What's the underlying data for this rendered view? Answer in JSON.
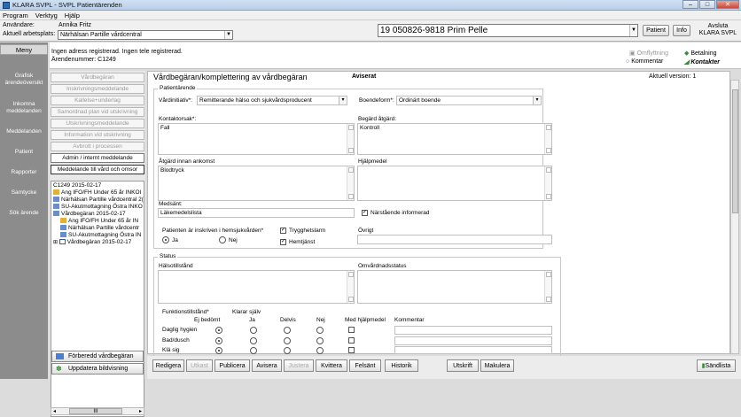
{
  "window": {
    "title": "KLARA SVPL - SVPL Patientärenden"
  },
  "menu": [
    "Program",
    "Verktyg",
    "Hjälp"
  ],
  "top": {
    "user_label": "Användare:",
    "user_value": "Annika Fritz",
    "workplace_label": "Aktuell arbetsplats:",
    "workplace_value": "Närhälsan Partille vårdcentral",
    "patient_value": "19 050826-9818 Prim Pelle",
    "patient_button": "Patient",
    "info_button": "Info",
    "exit_line1": "Avsluta",
    "exit_line2": "KLARA SVPL"
  },
  "sidebar": {
    "menu_label": "Meny",
    "items": [
      [
        "Grafisk",
        "ärendeöversikt"
      ],
      [
        "Inkomna",
        "meddelanden"
      ],
      [
        "Meddelanden"
      ],
      [
        "Patient"
      ],
      [
        "Rapporter"
      ],
      [
        "Samtycke"
      ],
      [
        "Sök ärende"
      ]
    ]
  },
  "address": {
    "line1": "Ingen adress registrerad.  Ingen tele registrerad.",
    "line2": "Ärendenummer: C1249",
    "btn_omflyttning": "Omflyttning",
    "btn_betalning": "Betalning",
    "btn_kommentar": "Kommentar",
    "btn_kontakter": "Kontakter"
  },
  "nav": {
    "items": [
      "Vårdbegäran",
      "Inskrivningsmeddelande",
      "Kallelse+underlag",
      "Samordnad plan vid utskrivning",
      "Utskrivningsmeddelande",
      "Information vid utskrivning",
      "Avbrott i processen",
      "Admin / internt meddelande",
      "Meddelande till vård och omsor"
    ]
  },
  "tree": [
    "C1249 2015-02-17",
    "Ang IFO/FH Under 65 år INKOI",
    "Närhälsan Partille vårdcentral 2(",
    "SU-Akutmottagning Östra INKO",
    "Vårdbegäran 2015-02-17",
    "Ang IFO/FH Under 65 år IN",
    "Närhälsan Partille vårdcentr",
    "SU-Akutmottagning Östra IN",
    "Vårdbegäran 2015-02-17"
  ],
  "scroll_label": "III",
  "left_buttons": {
    "prepared": "Förberedd vårdbegäran",
    "refresh": "Uppdatera bildvisning"
  },
  "form": {
    "title": "Vårdbegäran/komplettering av vårdbegäran",
    "status": "Aviserat",
    "version": "Aktuell version: 1",
    "patient_section": "Patientärende",
    "vardinitiativ_label": "Vårdinitiativ*:",
    "vardinitiativ_value": "Remitterande hälso och sjukvårdsproducent",
    "boendeform_label": "Boendeform*:",
    "boendeform_value": "Ordinärt boende",
    "kontaktorsak_label": "Kontaktorsak*:",
    "kontaktorsak_value": "Fall",
    "begard_label": "Begärd åtgärd:",
    "begard_value": "Kontroll",
    "atgard_label": "Åtgärd innan ankomst",
    "atgard_value": "Blodtryck",
    "hjalpmedel_label": "Hjälpmedel",
    "medsant_label": "Medsänt:",
    "medsant_value": "Läkemedelslista",
    "narstaende_label": "Närstående informerad",
    "hemsjuk_label": "Patienten är inskriven i hemsjukvården*",
    "ja_label": "Ja",
    "nej_label": "Nej",
    "trygghetslarm_label": "Trygghetslarm",
    "hemtjanst_label": "Hemtjänst",
    "ovrigt_label": "Övrigt",
    "status_section": "Status",
    "halsotillstand_label": "Hälsotillstånd",
    "omvardnad_label": "Omvårdnadsstatus",
    "funk_label": "Funktionstillstånd*",
    "klarar_label": "Klarar själv",
    "cols": [
      "Ej bedömt",
      "Ja",
      "Delvis",
      "Nej",
      "Med hjälpmedel",
      "Kommentar"
    ],
    "rows": [
      "Daglig hygien",
      "Bad/dusch",
      "Klä sig"
    ]
  },
  "bottom": {
    "buttons": [
      "Redigera",
      "Utkast",
      "Publicera",
      "Avisera",
      "Justera",
      "Kvittera",
      "Felsänt",
      "Historik",
      "Utskrift",
      "Makulera"
    ],
    "send": "Sändlista"
  }
}
